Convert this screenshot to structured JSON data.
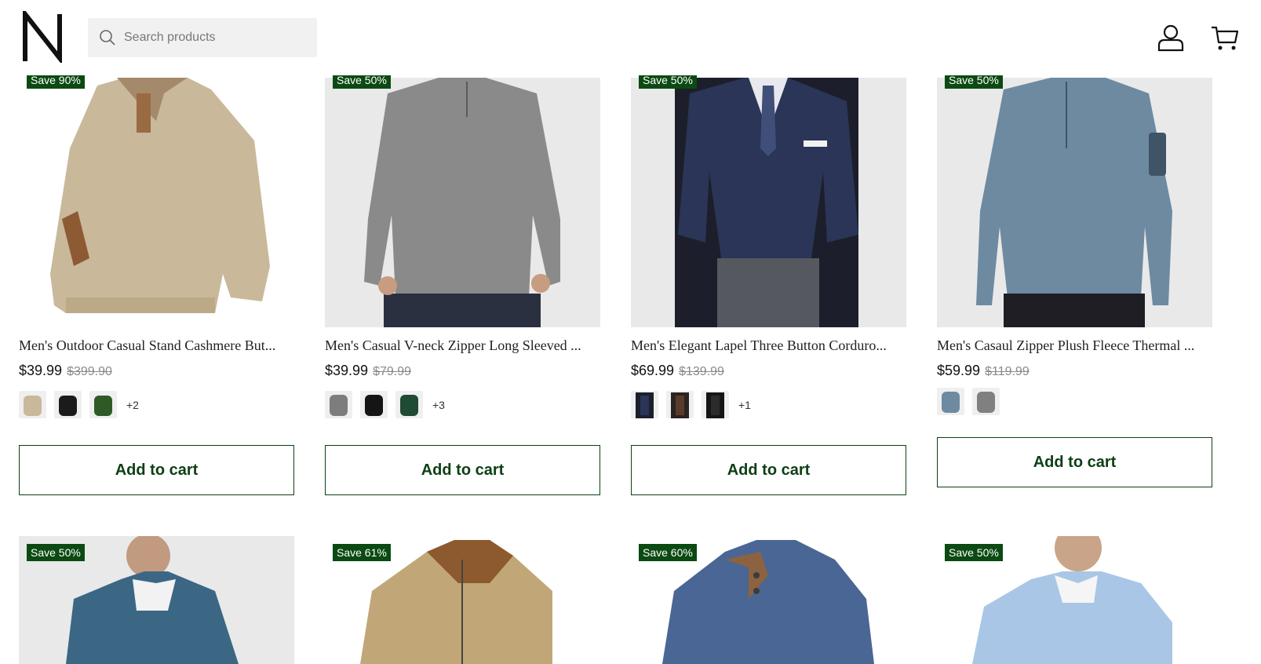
{
  "header": {
    "logo_text": "N",
    "search_placeholder": "Search products",
    "search_icon": "search-icon",
    "account_icon": "account-icon",
    "cart_icon": "cart-icon"
  },
  "products_row1": [
    {
      "badge": "Save 90%",
      "title": "Men's Outdoor Casual Stand Cashmere But...",
      "price": "$39.99",
      "compare_price": "$399.90",
      "more_colors": "+2",
      "add_to_cart": "Add to cart"
    },
    {
      "badge": "Save 50%",
      "title": "Men's Casual V-neck Zipper Long Sleeved ...",
      "price": "$39.99",
      "compare_price": "$79.99",
      "more_colors": "+3",
      "add_to_cart": "Add to cart"
    },
    {
      "badge": "Save 50%",
      "title": "Men's Elegant Lapel Three Button Corduro...",
      "price": "$69.99",
      "compare_price": "$139.99",
      "more_colors": "+1",
      "add_to_cart": "Add to cart"
    },
    {
      "badge": "Save 50%",
      "title": "Men's Casaul Zipper Plush Fleece Thermal ...",
      "price": "$59.99",
      "compare_price": "$119.99",
      "more_colors": "",
      "add_to_cart": "Add to cart"
    }
  ],
  "products_row2": [
    {
      "badge": "Save 50%"
    },
    {
      "badge": "Save 61%"
    },
    {
      "badge": "Save 60%"
    },
    {
      "badge": "Save 50%"
    }
  ],
  "colors": {
    "badge_bg": "#0b4a12",
    "button_text": "#0d4014",
    "image_bg": "#e9e9e9"
  }
}
